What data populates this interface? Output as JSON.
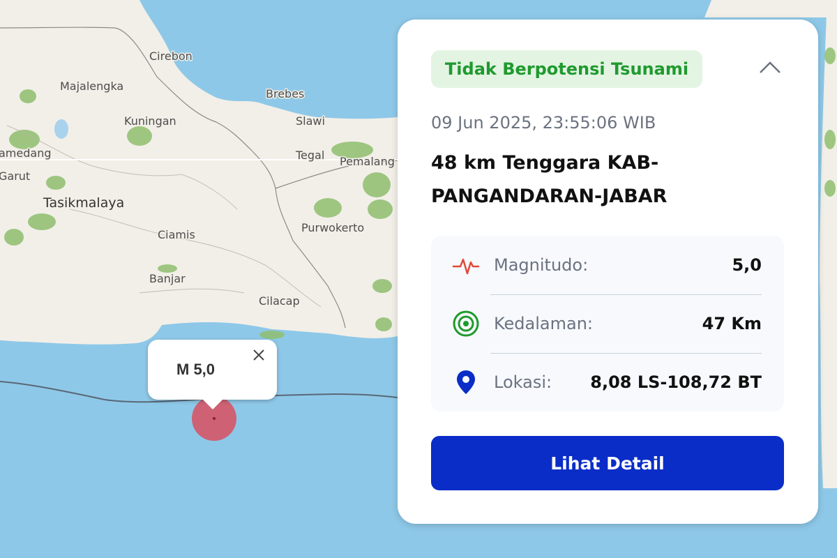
{
  "map": {
    "places": [
      {
        "id": "cirebon",
        "name": "Cirebon"
      },
      {
        "id": "majalengka",
        "name": "Majalengka"
      },
      {
        "id": "brebes",
        "name": "Brebes"
      },
      {
        "id": "kuningan",
        "name": "Kuningan"
      },
      {
        "id": "slawi",
        "name": "Slawi"
      },
      {
        "id": "sumedang",
        "name": "amedang"
      },
      {
        "id": "tegal",
        "name": "Tegal"
      },
      {
        "id": "pemalang",
        "name": "Pemalang"
      },
      {
        "id": "garut",
        "name": "Garut"
      },
      {
        "id": "tasikmalaya",
        "name": "Tasikmalaya"
      },
      {
        "id": "ciamis",
        "name": "Ciamis"
      },
      {
        "id": "purwokerto",
        "name": "Purwokerto"
      },
      {
        "id": "banjar",
        "name": "Banjar"
      },
      {
        "id": "cilacap",
        "name": "Cilacap"
      }
    ],
    "epicenter_color": "#d9505f",
    "land_color": "#f2efe8",
    "sea_color": "#8ec8e8",
    "forest_color": "#8fbe6e"
  },
  "popup": {
    "title": "M 5,0",
    "close_icon": "close-icon"
  },
  "card": {
    "badge": "Tidak Berpotensi Tsunami",
    "datetime": "09 Jun 2025, 23:55:06 WIB",
    "location_line1": "48 km Tenggara KAB-",
    "location_line2": "PANGANDARAN-JABAR",
    "rows": [
      {
        "label": "Magnitudo:",
        "value": "5,0",
        "icon": "seismograph-icon"
      },
      {
        "label": "Kedalaman:",
        "value": "47 Km",
        "icon": "concentric-circles-icon"
      },
      {
        "label": "Lokasi:",
        "value": "8,08 LS-108,72 BT",
        "icon": "map-pin-icon"
      }
    ],
    "button": "Lihat Detail",
    "accent_color": "#0a2dc8",
    "badge_color": "#1f9a2e"
  }
}
